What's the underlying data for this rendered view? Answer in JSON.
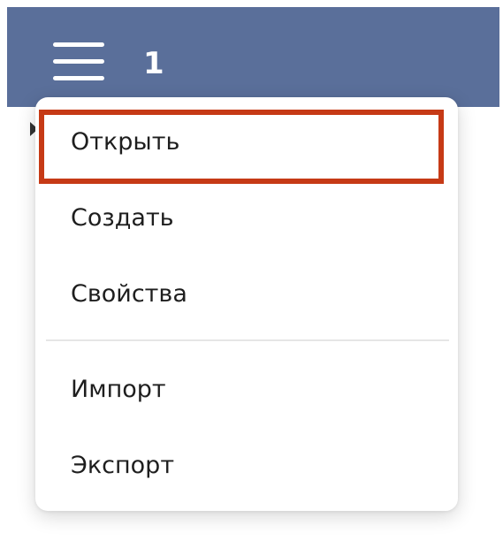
{
  "header": {
    "counter": "1",
    "menu_icon": "hamburger-menu-icon",
    "background_color": "#5a6f9a"
  },
  "menu": {
    "items": [
      {
        "label": "Открыть",
        "highlighted": true
      },
      {
        "label": "Создать"
      },
      {
        "label": "Свойства"
      },
      {
        "label": "Импорт"
      },
      {
        "label": "Экспорт"
      }
    ],
    "highlight_color": "#c63a16"
  }
}
